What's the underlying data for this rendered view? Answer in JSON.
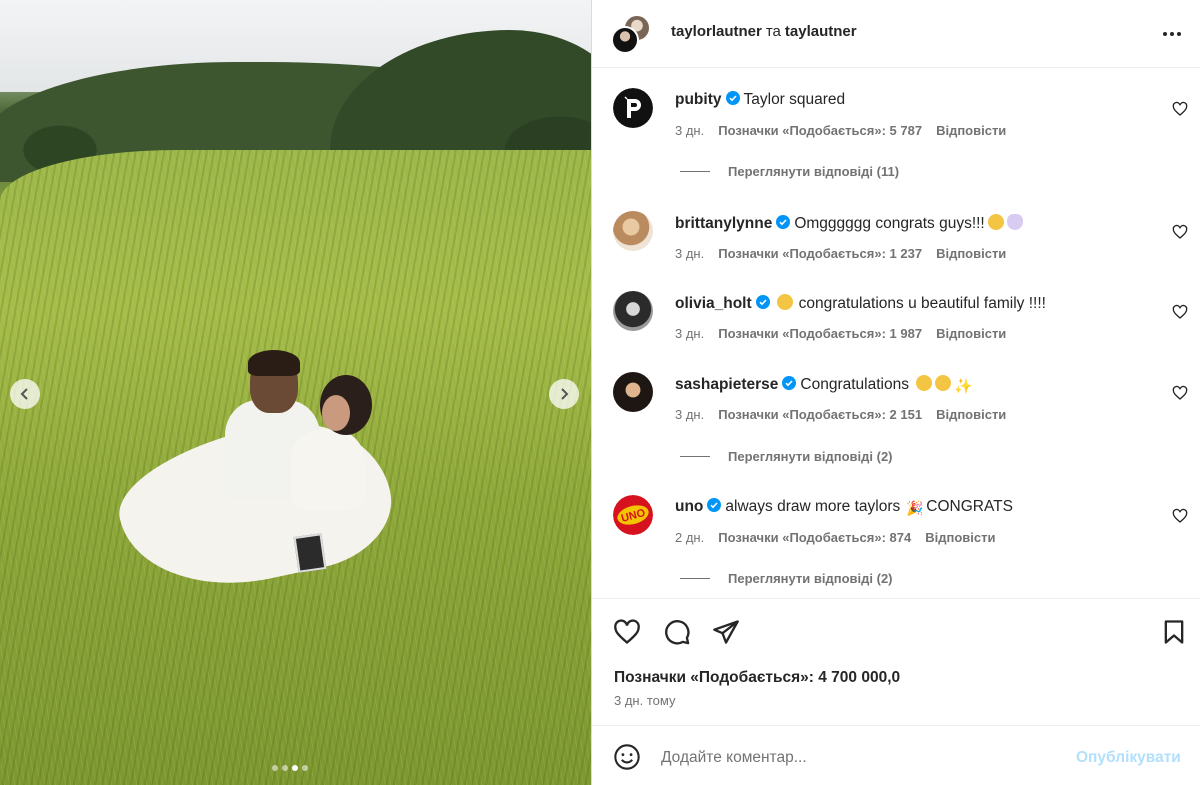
{
  "header": {
    "user1": "taylorlautner",
    "conjunction": "та",
    "user2": "taylautner"
  },
  "comments": [
    {
      "user": "pubity",
      "text": "Taylor squared",
      "time": "3 дн.",
      "likes": "Позначки «Подобається»: 5 787",
      "reply": "Відповісти",
      "view_replies": "Переглянути відповіді (11)"
    },
    {
      "user": "brittanylynne",
      "text": "Omgggggg congrats guys!!!",
      "time": "3 дн.",
      "likes": "Позначки «Подобається»: 1 237",
      "reply": "Відповісти"
    },
    {
      "user": "olivia_holt",
      "text": "congratulations u beautiful family !!!!",
      "time": "3 дн.",
      "likes": "Позначки «Подобається»: 1 987",
      "reply": "Відповісти"
    },
    {
      "user": "sashapieterse",
      "text": "Congratulations",
      "time": "3 дн.",
      "likes": "Позначки «Подобається»: 2 151",
      "reply": "Відповісти",
      "view_replies": "Переглянути відповіді (2)"
    },
    {
      "user": "uno",
      "text": "always draw more taylors",
      "text2": "CONGRATS",
      "time": "2 дн.",
      "likes": "Позначки «Подобається»: 874",
      "reply": "Відповісти",
      "view_replies": "Переглянути відповіді (2)"
    }
  ],
  "post": {
    "likes_total": "Позначки «Подобається»: 4 700 000,0",
    "time_ago": "3 дн. тому"
  },
  "add_comment": {
    "placeholder": "Додайте коментар...",
    "post_label": "Опублікувати"
  },
  "carousel": {
    "slide_count": 4,
    "active_slide": 3
  },
  "colors": {
    "verified": "#0095f6",
    "post_button": "#b2dffc",
    "meta_text": "#737373"
  },
  "icons": [
    "more-icon",
    "verified-icon",
    "heart-icon",
    "comment-icon",
    "share-icon",
    "bookmark-icon",
    "emoji-icon",
    "chevron-left-icon",
    "chevron-right-icon"
  ]
}
